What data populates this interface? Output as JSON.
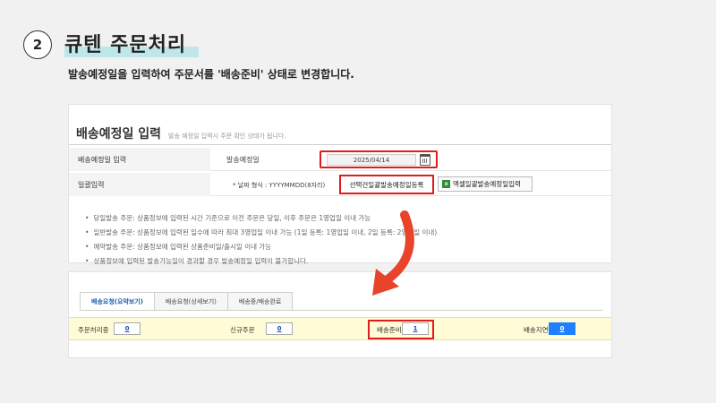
{
  "header": {
    "step_number": "2",
    "title": "큐텐 주문처리",
    "subtitle": "발송예정일을 입력하여 주문서를 '배송준비' 상태로 변경합니다."
  },
  "panel1": {
    "title": "배송예정일 입력",
    "description": "발송 예정일 입력시 주문 확인 상태가 됩니다.",
    "row1": {
      "label": "배송예정일 입력",
      "field_label": "발송예정일",
      "date_value": "2025/04/14"
    },
    "row2": {
      "label": "일괄입력",
      "format_text": "* 날짜 형식 : YYYYMMDD(8자리)",
      "select_button": "선택건일괄발송예정일등록",
      "excel_button": "액셀일괄발송예정일입력"
    },
    "notes": [
      "당일발송 주문: 상품정보에 입력된 시간 기준으로 이전 주문은 당일, 이후 주문은 1영업일 이내 가능",
      "일반발송 주문: 상품정보에 입력된 일수에 따라 최대 3영업일 이내 가능 (1일 등록: 1영업일 이내, 2일 등록: 2영업일 이내)",
      "예약발송 주문: 상품정보에 입력된 상품준비일/출시일 이내 가능",
      "상품정보에 입력된 발송가능일이 경과할 경우 발송예정일 입력이 불가합니다."
    ]
  },
  "panel2": {
    "tabs": [
      "배송요청(요약보기)",
      "배송요청(상세보기)",
      "배송중/배송완료"
    ],
    "status": [
      {
        "label": "주문처리중",
        "count": "0"
      },
      {
        "label": "신규주문",
        "count": "0"
      },
      {
        "label": "배송준비",
        "count": "1"
      },
      {
        "label": "배송지연",
        "count": "0"
      }
    ]
  },
  "colors": {
    "highlight": "#e01c1c",
    "accent_teal": "#bfe6e9",
    "status_bg": "#fffbd6",
    "blue": "#1e80ff"
  },
  "icons": {
    "calendar": "calendar-icon",
    "excel": "excel-icon",
    "arrow": "curved-arrow-icon"
  }
}
